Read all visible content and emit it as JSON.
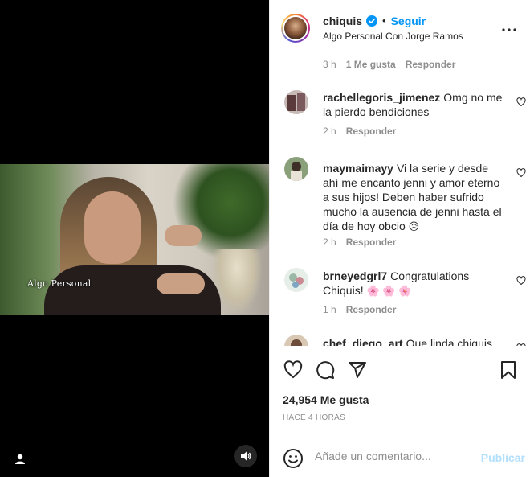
{
  "post": {
    "username": "chiquis",
    "follow_label": "Seguir",
    "separator": "•",
    "subtitle": "Algo Personal Con Jorge Ramos",
    "more_icon": "more-horizontal-icon"
  },
  "media": {
    "watermark": "Algo Personal",
    "user_tag_icon": "user-tag-icon",
    "mute_icon": "volume-icon"
  },
  "comments": {
    "first_meta": {
      "time": "3 h",
      "likes": "1 Me gusta",
      "reply": "Responder"
    },
    "items": [
      {
        "username": "rachellegoris_jimenez",
        "text": "Omg no me la pierdo bendiciones",
        "time": "2 h",
        "reply": "Responder"
      },
      {
        "username": "maymaimayy",
        "text": "Vi la serie y desde ahí me encanto jenni y amor eterno a sus hijos! Deben haber sufrido mucho la ausencia de jenni hasta el día de hoy obcio",
        "emoji": "😥",
        "time": "2 h",
        "reply": "Responder"
      },
      {
        "username": "brneyedgrl7",
        "text": "Congratulations Chiquis!",
        "emoji": "🌸 🌸 🌸",
        "time": "1 h",
        "reply": "Responder"
      },
      {
        "username": "chef_diego_art",
        "text": "Que linda chiquis"
      }
    ]
  },
  "actions": {
    "like_icon": "heart-icon",
    "comment_icon": "comment-icon",
    "share_icon": "share-icon",
    "save_icon": "bookmark-icon",
    "likes": "24,954 Me gusta",
    "time_ago": "HACE 4 HORAS"
  },
  "add_comment": {
    "placeholder": "Añade un comentario...",
    "post_label": "Publicar"
  },
  "colors": {
    "accent": "#0095f6",
    "muted": "#8e8e8e",
    "text": "#262626",
    "post_disabled": "#b2dffc"
  }
}
